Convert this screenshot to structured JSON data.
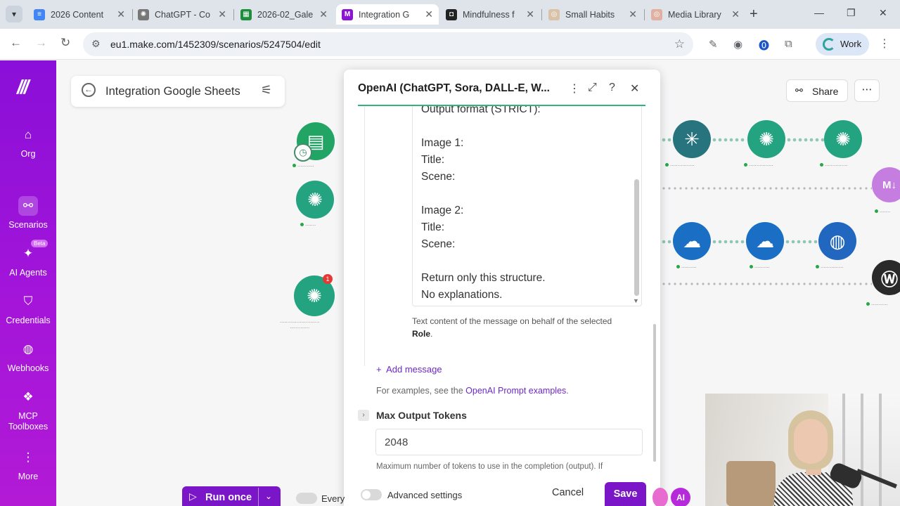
{
  "browser": {
    "tabs": [
      {
        "label": "2026 Content",
        "favicon_color": "#4285f4",
        "active": false
      },
      {
        "label": "ChatGPT - Co",
        "favicon_color": "#555555",
        "active": false
      },
      {
        "label": "2026-02_Gale",
        "favicon_color": "#1e8e3e",
        "active": false
      },
      {
        "label": "Integration G",
        "favicon_color": "#8a15d4",
        "active": true
      },
      {
        "label": "Mindfulness f",
        "favicon_color": "#222222",
        "active": false
      },
      {
        "label": "Small Habits",
        "favicon_color": "#d9c2a8",
        "active": false
      },
      {
        "label": "Media Library",
        "favicon_color": "#e0b0a0",
        "active": false
      }
    ],
    "url": "eu1.make.com/1452309/scenarios/5247504/edit",
    "profile_label": "Work"
  },
  "sidebar": {
    "items": [
      {
        "label": "Org",
        "icon": "home-icon"
      },
      {
        "label": "Scenarios",
        "icon": "share-nodes-icon"
      },
      {
        "label": "AI Agents",
        "icon": "ai-agent-icon",
        "badge": "Beta"
      },
      {
        "label": "Credentials",
        "icon": "shield-icon"
      },
      {
        "label": "Webhooks",
        "icon": "globe-icon"
      },
      {
        "label": "MCP Toolboxes",
        "icon": "mcp-icon"
      },
      {
        "label": "More",
        "icon": "more-vertical-icon"
      }
    ]
  },
  "canvas": {
    "scenario_title": "Integration Google Sheets",
    "share_label": "Share",
    "node_badge": "1"
  },
  "dialog": {
    "title": "OpenAI (ChatGPT, Sora, DALL-E, W...",
    "message_lines": [
      "Output format (STRICT):",
      "",
      "Image 1:",
      "Title:",
      "Scene:",
      "",
      "Image 2:",
      "Title:",
      "Scene:",
      "",
      "Return only this structure.",
      "No explanations."
    ],
    "message_help": "Text content of the message on behalf of the selected",
    "message_help_bold": "Role",
    "add_message": "Add message",
    "examples_text": "For examples, see the",
    "examples_link": "OpenAI Prompt examples",
    "max_tokens_label": "Max Output Tokens",
    "max_tokens_value": "2048",
    "max_tokens_help": "Maximum number of tokens to use in the completion (output). If",
    "advanced_settings": "Advanced settings",
    "cancel": "Cancel",
    "save": "Save"
  },
  "bottom_bar": {
    "run_once": "Run once",
    "schedule_label": "Every",
    "ai_label": "AI"
  },
  "colors": {
    "brand_purple": "#7a15c8",
    "openai_green": "#23a37f",
    "accent_green": "#2fb47c"
  }
}
